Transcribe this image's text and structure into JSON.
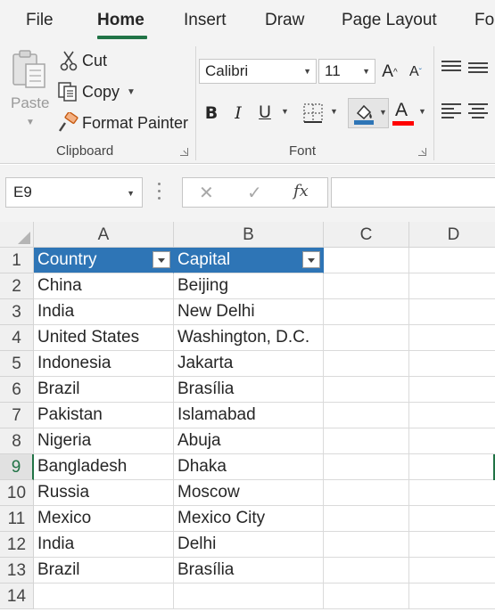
{
  "tabs": [
    "File",
    "Home",
    "Insert",
    "Draw",
    "Page Layout",
    "Fo"
  ],
  "active_tab": "Home",
  "clipboard": {
    "paste_label": "Paste",
    "cut_label": "Cut",
    "copy_label": "Copy",
    "format_painter_label": "Format Painter",
    "group_label": "Clipboard"
  },
  "font": {
    "family": "Calibri",
    "size": "11",
    "grow_label": "A",
    "shrink_label": "A",
    "bold_label": "B",
    "italic_label": "I",
    "underline_label": "U",
    "font_color_label": "A",
    "group_label": "Font"
  },
  "colors": {
    "accent_green": "#217346",
    "table_header": "#2e75b6",
    "fill_color": "#2e75b6",
    "font_color": "#ff0000"
  },
  "formula_bar": {
    "name_box": "E9",
    "cancel_symbol": "✕",
    "enter_symbol": "✓",
    "fx_label": "fx",
    "formula": ""
  },
  "sheet": {
    "columns": [
      "A",
      "B",
      "C",
      "D"
    ],
    "rows": [
      "1",
      "2",
      "3",
      "4",
      "5",
      "6",
      "7",
      "8",
      "9",
      "10",
      "11",
      "12",
      "13",
      "14"
    ],
    "selected_row": "9",
    "selected_cell": "E9",
    "table_headers": [
      "Country",
      "Capital"
    ],
    "table_rows": [
      [
        "China",
        "Beijing"
      ],
      [
        "India",
        "New Delhi"
      ],
      [
        "United States",
        "Washington, D.C."
      ],
      [
        "Indonesia",
        "Jakarta"
      ],
      [
        "Brazil",
        "Brasília"
      ],
      [
        "Pakistan",
        "Islamabad"
      ],
      [
        "Nigeria",
        "Abuja"
      ],
      [
        "Bangladesh",
        "Dhaka"
      ],
      [
        "Russia",
        "Moscow"
      ],
      [
        "Mexico",
        "Mexico City"
      ],
      [
        "India",
        "Delhi"
      ],
      [
        "Brazil",
        "Brasília"
      ]
    ]
  }
}
